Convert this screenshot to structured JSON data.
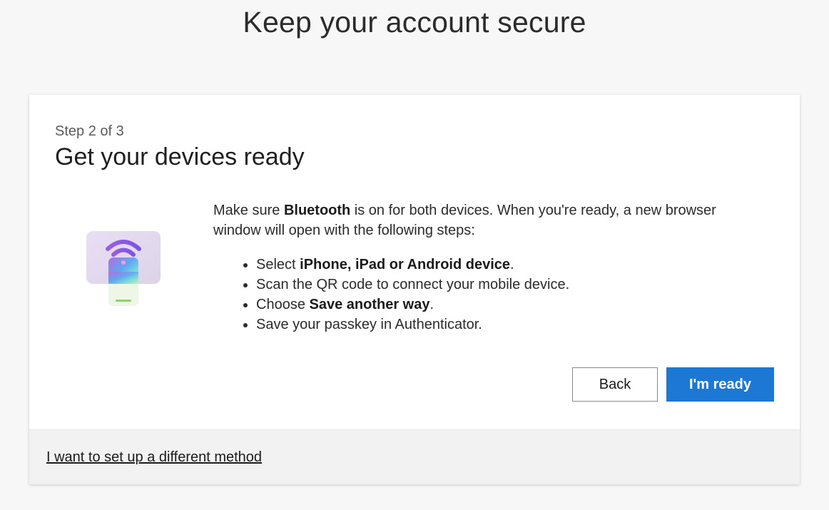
{
  "page": {
    "title": "Keep your account secure"
  },
  "card": {
    "step_label": "Step 2 of 3",
    "heading": "Get your devices ready",
    "illustration_icon": "phone-bluetooth-icon",
    "intro": {
      "prefix": "Make sure ",
      "bold": "Bluetooth",
      "suffix": " is on for both devices. When you're ready, a new browser window will open with the following steps:"
    },
    "steps": [
      {
        "prefix": "Select ",
        "bold": "iPhone, iPad or Android device",
        "suffix": "."
      },
      {
        "prefix": "Scan the QR code to connect your mobile device.",
        "bold": "",
        "suffix": ""
      },
      {
        "prefix": "Choose ",
        "bold": "Save another way",
        "suffix": "."
      },
      {
        "prefix": "Save your passkey in Authenticator.",
        "bold": "",
        "suffix": ""
      }
    ],
    "back_label": "Back",
    "ready_label": "I'm ready"
  },
  "footer": {
    "link_label": "I want to set up a different method"
  },
  "colors": {
    "primary": "#1c78d4",
    "background": "#f7f7f7",
    "footer_background": "#f2f2f2"
  }
}
